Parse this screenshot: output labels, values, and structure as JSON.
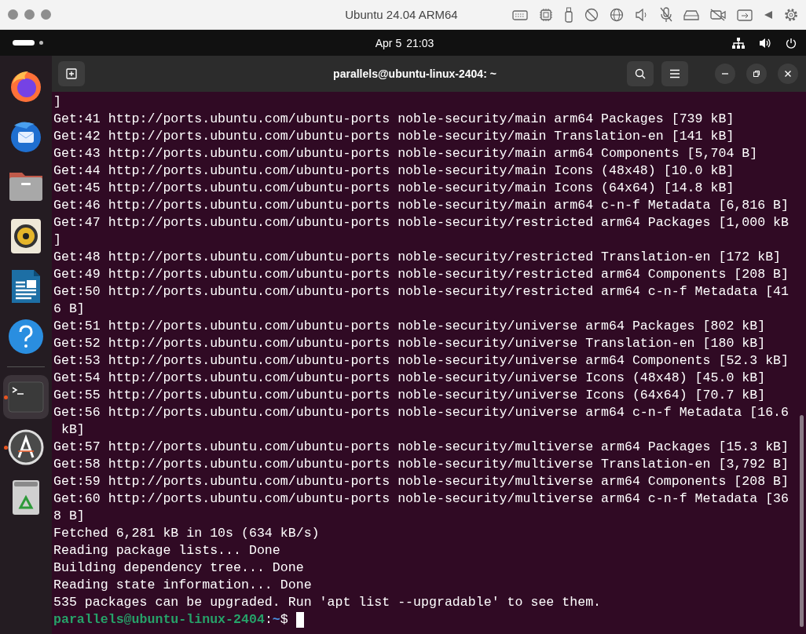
{
  "window": {
    "title": "Ubuntu 24.04 ARM64"
  },
  "topbar": {
    "date": "Apr 5",
    "time": "21:03"
  },
  "dock": {
    "items": [
      {
        "kind": "firefox",
        "selected": false,
        "running": false
      },
      {
        "kind": "thunderbird",
        "selected": false,
        "running": false
      },
      {
        "kind": "files",
        "selected": false,
        "running": false
      },
      {
        "kind": "rhythmbox",
        "selected": false,
        "running": false
      },
      {
        "kind": "writer",
        "selected": false,
        "running": false
      },
      {
        "kind": "help",
        "selected": false,
        "running": false
      },
      {
        "kind": "separator"
      },
      {
        "kind": "terminal",
        "selected": true,
        "running": true
      },
      {
        "kind": "appcenter",
        "selected": false,
        "running": true
      },
      {
        "kind": "trash",
        "selected": false,
        "running": false
      }
    ]
  },
  "terminal": {
    "title": "parallels@ubuntu-linux-2404: ~",
    "lines": [
      "]",
      "Get:41 http://ports.ubuntu.com/ubuntu-ports noble-security/main arm64 Packages [739 kB]",
      "Get:42 http://ports.ubuntu.com/ubuntu-ports noble-security/main Translation-en [141 kB]",
      "Get:43 http://ports.ubuntu.com/ubuntu-ports noble-security/main arm64 Components [5,704 B]",
      "Get:44 http://ports.ubuntu.com/ubuntu-ports noble-security/main Icons (48x48) [10.0 kB]",
      "Get:45 http://ports.ubuntu.com/ubuntu-ports noble-security/main Icons (64x64) [14.8 kB]",
      "Get:46 http://ports.ubuntu.com/ubuntu-ports noble-security/main arm64 c-n-f Metadata [6,816 B]",
      "Get:47 http://ports.ubuntu.com/ubuntu-ports noble-security/restricted arm64 Packages [1,000 kB",
      "]",
      "Get:48 http://ports.ubuntu.com/ubuntu-ports noble-security/restricted Translation-en [172 kB]",
      "Get:49 http://ports.ubuntu.com/ubuntu-ports noble-security/restricted arm64 Components [208 B]",
      "Get:50 http://ports.ubuntu.com/ubuntu-ports noble-security/restricted arm64 c-n-f Metadata [41",
      "6 B]",
      "Get:51 http://ports.ubuntu.com/ubuntu-ports noble-security/universe arm64 Packages [802 kB]",
      "Get:52 http://ports.ubuntu.com/ubuntu-ports noble-security/universe Translation-en [180 kB]",
      "Get:53 http://ports.ubuntu.com/ubuntu-ports noble-security/universe arm64 Components [52.3 kB]",
      "Get:54 http://ports.ubuntu.com/ubuntu-ports noble-security/universe Icons (48x48) [45.0 kB]",
      "Get:55 http://ports.ubuntu.com/ubuntu-ports noble-security/universe Icons (64x64) [70.7 kB]",
      "Get:56 http://ports.ubuntu.com/ubuntu-ports noble-security/universe arm64 c-n-f Metadata [16.6",
      " kB]",
      "Get:57 http://ports.ubuntu.com/ubuntu-ports noble-security/multiverse arm64 Packages [15.3 kB]",
      "Get:58 http://ports.ubuntu.com/ubuntu-ports noble-security/multiverse Translation-en [3,792 B]",
      "Get:59 http://ports.ubuntu.com/ubuntu-ports noble-security/multiverse arm64 Components [208 B]",
      "Get:60 http://ports.ubuntu.com/ubuntu-ports noble-security/multiverse arm64 c-n-f Metadata [36",
      "8 B]",
      "Fetched 6,281 kB in 10s (634 kB/s)",
      "Reading package lists... Done",
      "Building dependency tree... Done",
      "Reading state information... Done",
      "535 packages can be upgraded. Run 'apt list --upgradable' to see them."
    ],
    "prompt": {
      "user_host": "parallels@ubuntu-linux-2404",
      "separator": ":",
      "path": "~",
      "symbol": "$"
    }
  }
}
